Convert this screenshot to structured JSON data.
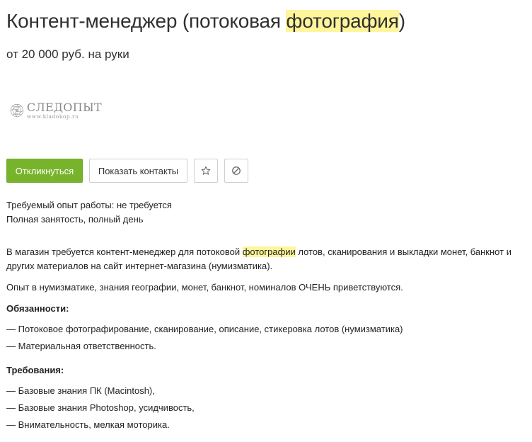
{
  "vacancy": {
    "title_before": "Контент-менеджер (потоковая ",
    "title_highlight": "фотография",
    "title_after": ")",
    "salary": "от 20 000 руб. на руки"
  },
  "company": {
    "logo_name": "СЛЕДОПЫТ",
    "logo_url": "www.kladokop.ru"
  },
  "actions": {
    "respond_label": "Откликнуться",
    "show_contacts_label": "Показать контакты",
    "favorite_icon": "star-icon",
    "hide_icon": "block-icon"
  },
  "meta": {
    "experience": "Требуемый опыт работы: не требуется",
    "employment": "Полная занятость, полный день"
  },
  "description": {
    "intro_before": "В магазин требуется контент-менеджер для потоковой ",
    "intro_highlight": "фотографии",
    "intro_after": " лотов, сканирования и выкладки монет, банкнот и других материалов на сайт интернет-магазина (нумизматика).",
    "experience_note": "Опыт в нумизматике, знания географии, монет, банкнот, номиналов ОЧЕНЬ приветствуются.",
    "duties_heading": "Обязанности:",
    "duties": [
      "— Потоковое фотографирование, сканирование, описание, стикеровка лотов (нумизматика)",
      "— Материальная ответственность."
    ],
    "requirements_heading": "Требования:",
    "requirements": [
      "— Базовые знания ПК (Macintosh),",
      "— Базовые знания Photoshop, усидчивость,",
      "— Внимательность, мелкая моторика."
    ]
  },
  "colors": {
    "accent": "#78b42b",
    "highlight": "#fff59a"
  }
}
